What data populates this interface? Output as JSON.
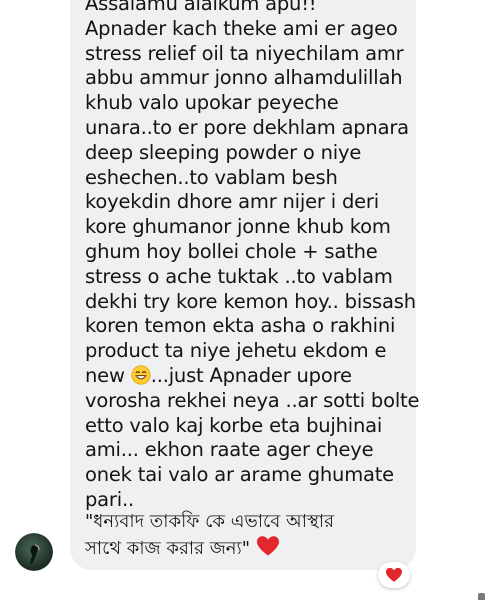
{
  "message": {
    "lines": [
      "Assalamu alaikum apu!!",
      "Apnader kach theke ami er ageo",
      "stress relief oil ta niyechilam amr",
      "abbu ammur jonno alhamdulillah",
      "khub valo upokar peyeche",
      "unara..to er pore dekhlam apnara",
      "deep sleeping powder o niye",
      "eshechen..to vablam besh",
      "koyekdin dhore amr nijer i deri",
      "kore ghumanor jonne khub  kom",
      "ghum hoy bollei chole +  sathe",
      "stress o ache tuktak ..to vablam",
      "dekhi try kore kemon hoy.. bissash",
      "koren temon ekta asha o rakhini",
      "product ta niye jehetu ekdom e",
      "...just Apnader upore",
      "vorosha rekhei neya ..ar sotti bolte",
      "etto valo kaj korbe eta bujhinai",
      "ami... ekhon raate ager cheye",
      "onek tai valo ar arame ghumate",
      "pari.."
    ],
    "new_word": "new",
    "bengali_line_1": "\"ধন্যবাদ তাকফি কে এভাবে আস্থার",
    "bengali_line_2": "সাথে কাজ করার জন্য\""
  },
  "icons": {
    "inline_emoji": "grinning-smiling-face-emoji",
    "heart": "red-heart-emoji",
    "reaction": "heart-reaction",
    "avatar": "sender-avatar"
  },
  "colors": {
    "bubble": "#eff0f2",
    "text": "#141414",
    "heart": "#e4262d"
  }
}
